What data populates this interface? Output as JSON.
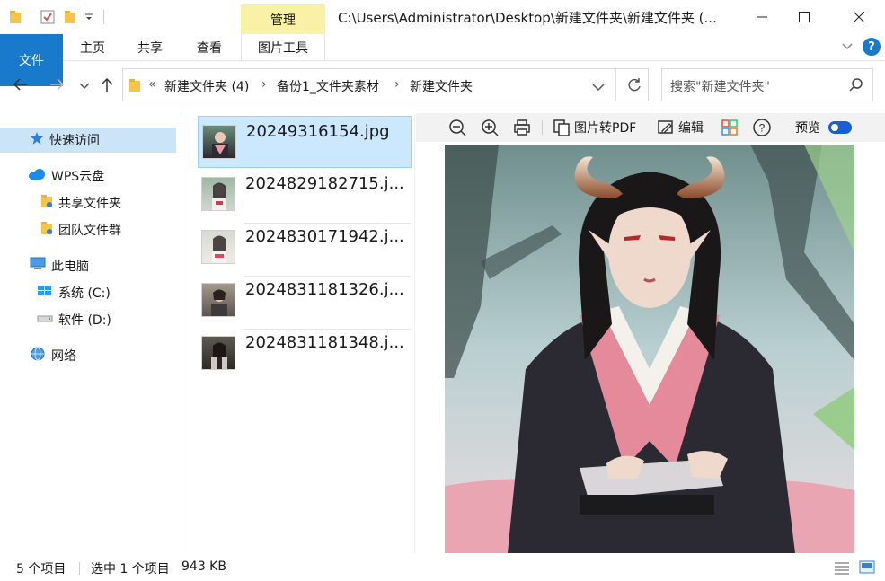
{
  "window": {
    "title": "C:\\Users\\Administrator\\Desktop\\新建文件夹\\新建文件夹 (...",
    "context_tab": "管理"
  },
  "ribbon": {
    "tabs": [
      "文件",
      "主页",
      "共享",
      "查看",
      "图片工具"
    ]
  },
  "address": {
    "overflow": "«",
    "crumbs": [
      "新建文件夹 (4)",
      "备份1_文件夹素材",
      "新建文件夹"
    ],
    "search_placeholder": "搜索\"新建文件夹\""
  },
  "nav": {
    "quick_access": "快速访问",
    "wps": "WPS云盘",
    "shared": "共享文件夹",
    "team": "团队文件群",
    "this_pc": "此电脑",
    "system_drive": "系统 (C:)",
    "software_drive": "软件 (D:)",
    "network": "网络"
  },
  "files": [
    {
      "name": "20249316154.jpg"
    },
    {
      "name": "2024829182715.j..."
    },
    {
      "name": "2024830171942.j..."
    },
    {
      "name": "2024831181326.j..."
    },
    {
      "name": "2024831181348.j..."
    }
  ],
  "preview_toolbar": {
    "to_pdf": "图片转PDF",
    "edit": "编辑",
    "preview": "预览"
  },
  "status": {
    "count": "5 个项目",
    "selected": "选中 1 个项目",
    "size": "943 KB"
  },
  "colors": {
    "accent": "#1979ca",
    "manage_tab": "#f9f1a5",
    "selection": "#cce8ff"
  }
}
